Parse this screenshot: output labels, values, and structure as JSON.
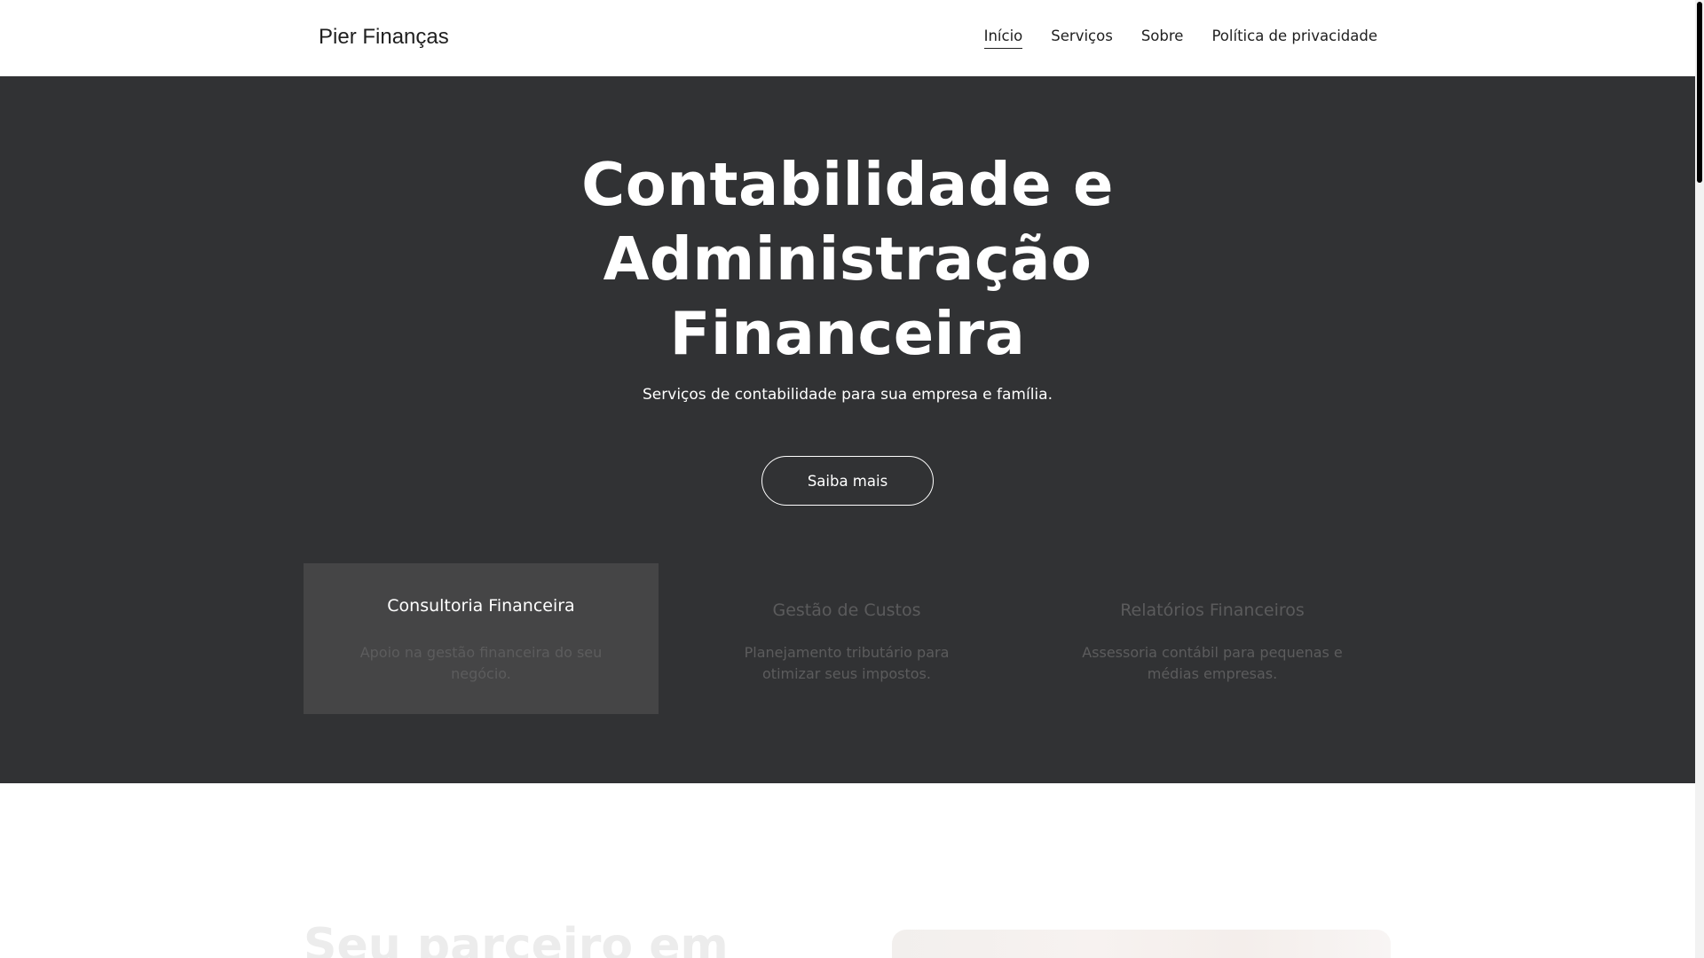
{
  "header": {
    "brand": "Pier Finanças",
    "nav": [
      {
        "label": "Início",
        "active": true
      },
      {
        "label": "Serviços",
        "active": false
      },
      {
        "label": "Sobre",
        "active": false
      },
      {
        "label": "Política de privacidade",
        "active": false
      }
    ]
  },
  "hero": {
    "title_line1": "Contabilidade e",
    "title_line2": "Administração",
    "title_line3": "Financeira",
    "subtitle": "Serviços de contabilidade para sua empresa e família.",
    "cta_label": "Saiba mais",
    "background_color": "#313234"
  },
  "cards": [
    {
      "title": "Consultoria Financeira",
      "description": "Apoio na gestão financeira do seu negócio.",
      "active": true
    },
    {
      "title": "Gestão de Custos",
      "description": "Planejamento tributário para otimizar seus impostos.",
      "active": false
    },
    {
      "title": "Relatórios Financeiros",
      "description": "Assessoria contábil para pequenas e médias empresas.",
      "active": false
    }
  ],
  "about": {
    "title_partial": "Seu parceiro em"
  }
}
